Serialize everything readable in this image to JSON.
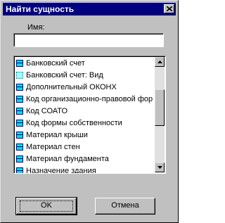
{
  "window": {
    "title": "Найти сущность"
  },
  "form": {
    "name_label": "Имя:",
    "name_value": ""
  },
  "list": {
    "items": [
      {
        "label": "Банковский счет",
        "icon": "entity-icon"
      },
      {
        "label": "Банковский счет: Вид",
        "icon": "entity-dotted-icon"
      },
      {
        "label": "Дополнительный ОКОНХ",
        "icon": "entity-icon"
      },
      {
        "label": "Код организационно-правовой фор",
        "icon": "entity-icon"
      },
      {
        "label": "Код СОАТО",
        "icon": "entity-icon"
      },
      {
        "label": "Код формы собственности",
        "icon": "entity-icon"
      },
      {
        "label": "Материал крыши",
        "icon": "entity-icon"
      },
      {
        "label": "Материал стен",
        "icon": "entity-icon"
      },
      {
        "label": "Материал фундамента",
        "icon": "entity-icon"
      },
      {
        "label": "Назначение здания",
        "icon": "entity-icon"
      }
    ]
  },
  "buttons": {
    "ok": "OK",
    "cancel": "Отмена"
  }
}
